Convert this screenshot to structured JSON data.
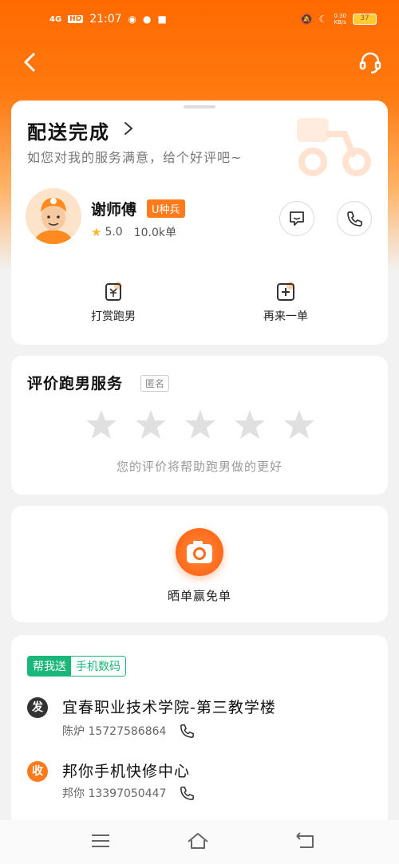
{
  "status_bar": {
    "signal": "4G",
    "hd": "HD",
    "time": "21:07",
    "net_speed_value": "0.30",
    "net_speed_unit": "KB/s",
    "battery": "37"
  },
  "icons": {
    "back": "chevron-left-icon",
    "service": "headset-icon"
  },
  "delivery": {
    "status_title": "配送完成",
    "status_sub": "如您对我的服务满意，给个好评吧~",
    "courier_name": "谢师傅",
    "courier_badge": "U种兵",
    "rating": "5.0",
    "orders": "10.0k单",
    "actions": [
      {
        "label": "打赏跑男",
        "icon": "reward-cup-icon"
      },
      {
        "label": "再来一单",
        "icon": "plus-square-icon"
      }
    ]
  },
  "rating": {
    "title": "评价跑男服务",
    "anon": "匿名",
    "stars": 0,
    "hint": "您的评价将帮助跑男做的更好"
  },
  "share": {
    "label": "晒单赢免单"
  },
  "order": {
    "tag_type": "帮我送",
    "tag_category": "手机数码",
    "send": {
      "badge": "发",
      "address": "宜春职业技术学院-第三教学楼",
      "contact_name": "陈炉",
      "phone": "15727586864"
    },
    "receive": {
      "badge": "收",
      "address": "邦你手机快修中心",
      "contact_name": "邦你",
      "phone": "13397050447"
    }
  },
  "colors": {
    "brand": "#ff6a00",
    "accent_green": "#19b77a",
    "star_gray": "#e0e0e0"
  }
}
